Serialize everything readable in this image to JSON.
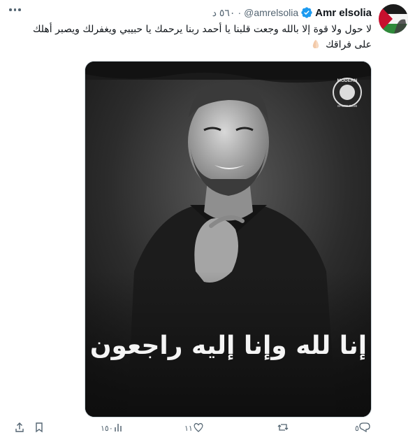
{
  "tweet": {
    "author_name": "Amr elsolia",
    "handle": "@amrelsolia",
    "separator": "·",
    "time": "٥٦٠ د",
    "text": "لا حول ولا قوة إلا بالله وجعت قلبنا يا أحمد ربنا يرحمك يا حبيبي ويغفرلك ويصبر أهلك على فراقك"
  },
  "media": {
    "calligraphy": "إنا لله وإنا إليه راجعون",
    "logo_top": "MODERN",
    "logo_bottom": "SPORT CLUB"
  },
  "actions": [
    {
      "name": "share",
      "count": ""
    },
    {
      "name": "bookmark",
      "count": ""
    },
    {
      "name": "views",
      "count": "١٥٠"
    },
    {
      "name": "like",
      "count": "١١"
    },
    {
      "name": "retweet",
      "count": ""
    },
    {
      "name": "reply",
      "count": "٥"
    }
  ],
  "colors": {
    "text_primary": "#0f1419",
    "text_secondary": "#536471",
    "verified": "#1d9bf0"
  }
}
